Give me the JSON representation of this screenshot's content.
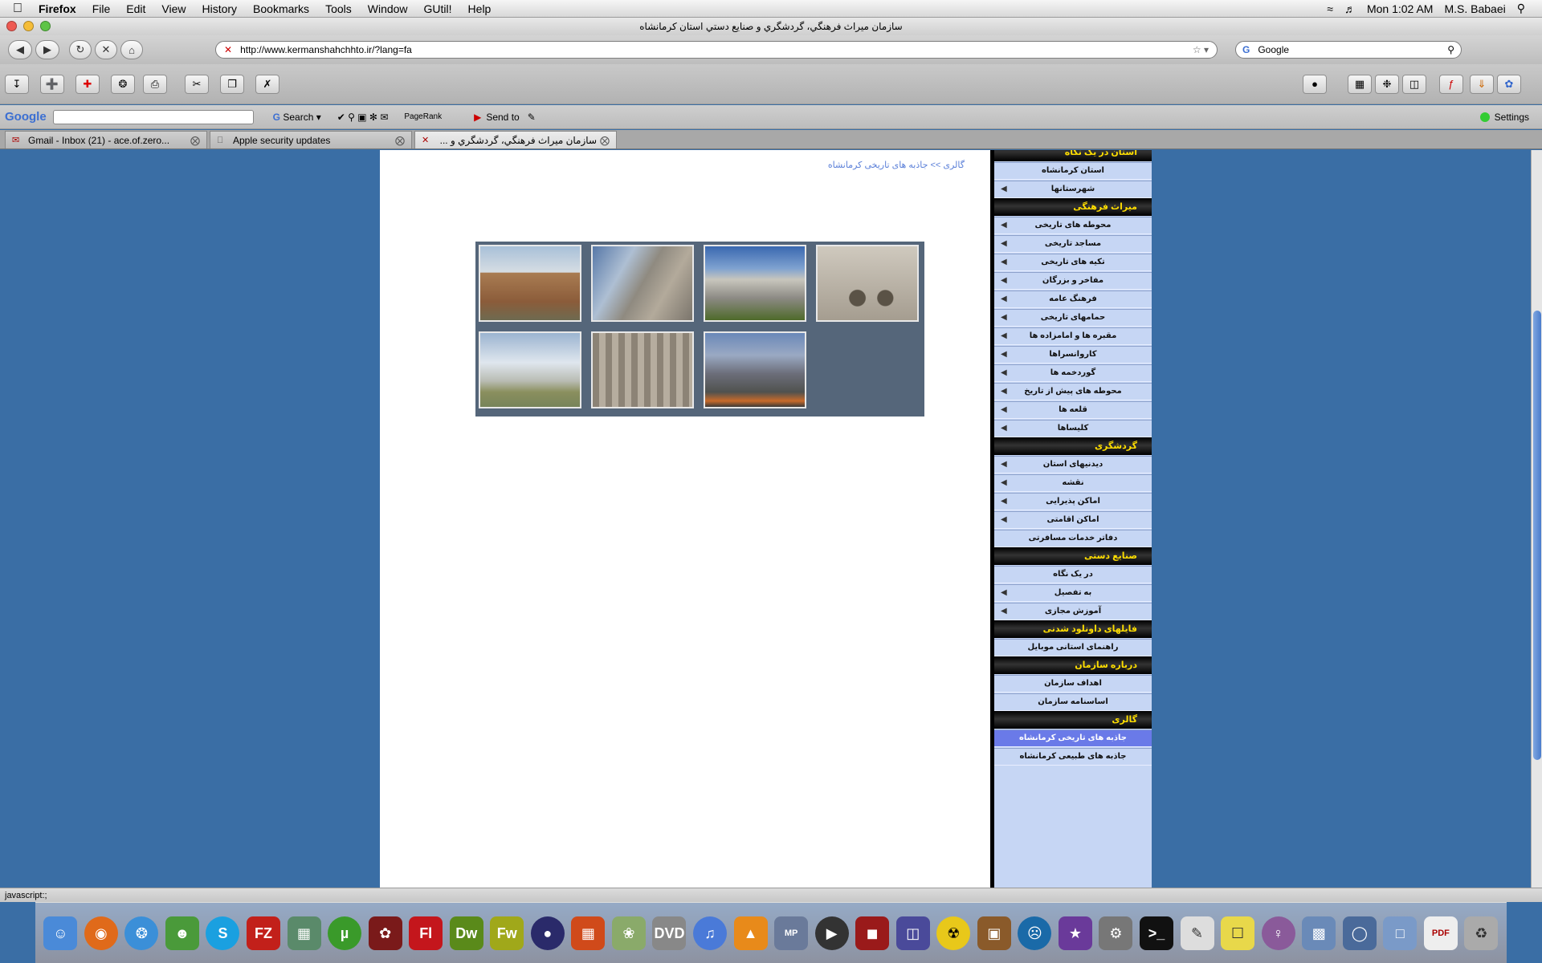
{
  "menubar": {
    "app": "Firefox",
    "items": [
      "File",
      "Edit",
      "View",
      "History",
      "Bookmarks",
      "Tools",
      "Window",
      "GUtil!",
      "Help"
    ],
    "clock": "Mon 1:02 AM",
    "user": "M.S. Babaei"
  },
  "window": {
    "title": "سازمان ميراث فرهنگي، گردشگري و صنايع دستي استان کرمانشاه"
  },
  "nav": {
    "url": "http://www.kermanshahchhto.ir/?lang=fa",
    "search_value": "Google"
  },
  "googlebar": {
    "logo": "Google",
    "search_label": "Search",
    "pagerank_label": "PageRank",
    "sendto_label": "Send to",
    "settings_label": "Settings"
  },
  "tabs": [
    {
      "label": "Gmail - Inbox (21) - ace.of.zero..."
    },
    {
      "label": "Apple security updates"
    },
    {
      "label": "سازمان ميراث فرهنگي، گردشگري و ..."
    }
  ],
  "page": {
    "breadcrumb": "گالری >> جاذبه های تاریخی کرمانشاه",
    "gallery_count": 7
  },
  "sidebar": {
    "sections": [
      {
        "title": "استان در یک نگاه",
        "items": [
          {
            "label": "استان کرمانشاه",
            "arrow": false
          },
          {
            "label": "شهرستانها",
            "arrow": true
          }
        ]
      },
      {
        "title": "میراث فرهنگی",
        "items": [
          {
            "label": "محوطه های تاریخی",
            "arrow": true
          },
          {
            "label": "مساجد تاریخی",
            "arrow": true
          },
          {
            "label": "تکیه های تاریخی",
            "arrow": true
          },
          {
            "label": "مفاخر و بزرگان",
            "arrow": true
          },
          {
            "label": "فرهنگ عامه",
            "arrow": true
          },
          {
            "label": "حمامهای تاریخی",
            "arrow": true
          },
          {
            "label": "مقبره ها و امامزاده ها",
            "arrow": true
          },
          {
            "label": "کاروانسراها",
            "arrow": true
          },
          {
            "label": "گوردخمه ها",
            "arrow": true
          },
          {
            "label": "محوطه های پیش از تاریخ",
            "arrow": true
          },
          {
            "label": "قلعه ها",
            "arrow": true
          },
          {
            "label": "کلیساها",
            "arrow": true
          }
        ]
      },
      {
        "title": "گردشگری",
        "items": [
          {
            "label": "دیدنیهای استان",
            "arrow": true
          },
          {
            "label": "نقشه",
            "arrow": true
          },
          {
            "label": "اماکن پذیرایی",
            "arrow": true
          },
          {
            "label": "اماکن اقامتی",
            "arrow": true
          },
          {
            "label": "دفاتر خدمات مسافرتی",
            "arrow": false
          }
        ]
      },
      {
        "title": "صنایع دستی",
        "items": [
          {
            "label": "در یک نگاه",
            "arrow": false
          },
          {
            "label": "به تفصیل",
            "arrow": true
          },
          {
            "label": "آموزش مجازی",
            "arrow": true
          }
        ]
      },
      {
        "title": "فایلهای داونلود شدنی",
        "items": [
          {
            "label": "راهنمای استانی موبایل",
            "arrow": false
          }
        ]
      },
      {
        "title": "درباره سازمان",
        "items": [
          {
            "label": "اهداف سازمان",
            "arrow": false
          },
          {
            "label": "اساسنامه سازمان",
            "arrow": false
          }
        ]
      },
      {
        "title": "گالری",
        "items": [
          {
            "label": "جاذبه های تاریخی کرمانشاه",
            "arrow": false,
            "active": true
          },
          {
            "label": "جاذبه های طبیعی کرمانشاه",
            "arrow": false
          }
        ]
      }
    ]
  },
  "status": {
    "text": "javascript:;"
  },
  "colors": {
    "desktop": "#3a6ea5",
    "sidebar_bg": "#c6d6f4",
    "sidebar_head_text": "#ffde00",
    "active_item": "#6a7ae8",
    "gallery_bg": "#55667a"
  }
}
